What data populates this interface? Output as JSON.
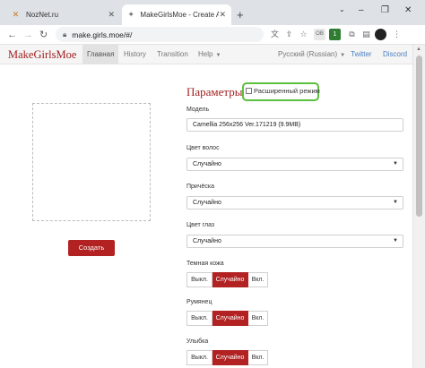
{
  "browser": {
    "tabs": [
      {
        "title": "NozNet.ru",
        "favicon": "x-logo-icon"
      },
      {
        "title": "MakeGirlsMoe - Create Anime C",
        "favicon": "sparkle-icon"
      }
    ],
    "new_tab": "+",
    "url": "make.girls.moe/#/",
    "extension_badge": "1"
  },
  "site": {
    "brand": "MakeGirlsMoe",
    "nav": [
      "Главная",
      "History",
      "Transition",
      "Help"
    ],
    "language": "Русский (Russian)",
    "links": [
      "Twitter",
      "Discord"
    ]
  },
  "generate_button": "Создать",
  "params": {
    "title": "Параметры",
    "advanced_label": "Расширенный режим",
    "model_label": "Модель",
    "model_value": "Camellia 256x256 Ver.171219 (9.9MB)",
    "hair_color_label": "Цвет волос",
    "hair_color_value": "Случайно",
    "hairstyle_label": "Причёска",
    "hairstyle_value": "Случайно",
    "eye_color_label": "Цвет глаз",
    "eye_color_value": "Случайно",
    "dark_skin_label": "Темная кожа",
    "blush_label": "Румянец",
    "smile_label": "Улыбка",
    "toggle_options": [
      "Выкл.",
      "Случайно",
      "Вкл."
    ]
  },
  "colors": {
    "accent": "#b22222",
    "highlight": "#5bbf3f",
    "link": "#4a7fc0"
  }
}
